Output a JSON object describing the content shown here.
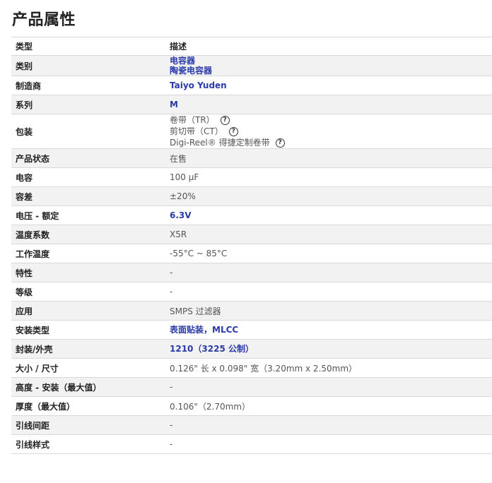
{
  "page_title": "产品属性",
  "table": {
    "header": {
      "type": "类型",
      "description": "描述"
    },
    "rows": [
      {
        "name": "类别",
        "values": [
          {
            "text": "电容器",
            "link": true
          },
          {
            "text": "陶瓷电容器",
            "link": true
          }
        ]
      },
      {
        "name": "制造商",
        "values": [
          {
            "text": "Taiyo Yuden",
            "link": true
          }
        ]
      },
      {
        "name": "系列",
        "values": [
          {
            "text": "M",
            "link": true
          }
        ]
      },
      {
        "name": "包装",
        "values": [
          {
            "text": "卷带（TR）",
            "help": true
          },
          {
            "text": "剪切带（CT）",
            "help": true
          },
          {
            "text": "Digi-Reel® 得捷定制卷带",
            "help": true
          }
        ]
      },
      {
        "name": "产品状态",
        "values": [
          {
            "text": "在售"
          }
        ]
      },
      {
        "name": "电容",
        "values": [
          {
            "text": "100 µF"
          }
        ]
      },
      {
        "name": "容差",
        "values": [
          {
            "text": "±20%"
          }
        ]
      },
      {
        "name": "电压 - 额定",
        "values": [
          {
            "text": "6.3V",
            "link": true
          }
        ]
      },
      {
        "name": "温度系数",
        "values": [
          {
            "text": "X5R"
          }
        ]
      },
      {
        "name": "工作温度",
        "values": [
          {
            "text": "-55°C ~ 85°C"
          }
        ]
      },
      {
        "name": "特性",
        "values": [
          {
            "text": "-"
          }
        ]
      },
      {
        "name": "等级",
        "values": [
          {
            "text": "-"
          }
        ]
      },
      {
        "name": "应用",
        "values": [
          {
            "text": "SMPS 过滤器"
          }
        ]
      },
      {
        "name": "安装类型",
        "values": [
          {
            "text": "表面贴装，MLCC",
            "link": true
          }
        ]
      },
      {
        "name": "封装/外壳",
        "values": [
          {
            "text": "1210（3225 公制）",
            "link": true
          }
        ]
      },
      {
        "name": "大小 / 尺寸",
        "values": [
          {
            "text": "0.126\" 长 x 0.098\" 宽（3.20mm x 2.50mm）"
          }
        ]
      },
      {
        "name": "高度 - 安装（最大值）",
        "values": [
          {
            "text": "-"
          }
        ]
      },
      {
        "name": "厚度（最大值）",
        "values": [
          {
            "text": "0.106\"（2.70mm）"
          }
        ]
      },
      {
        "name": "引线间距",
        "values": [
          {
            "text": "-"
          }
        ]
      },
      {
        "name": "引线样式",
        "values": [
          {
            "text": "-"
          }
        ]
      }
    ]
  },
  "icons": {
    "help": "help-circle-icon"
  },
  "colors": {
    "link": "#2a3aa8",
    "stripe": "#f2f2f2",
    "border": "#d9d9d9"
  }
}
